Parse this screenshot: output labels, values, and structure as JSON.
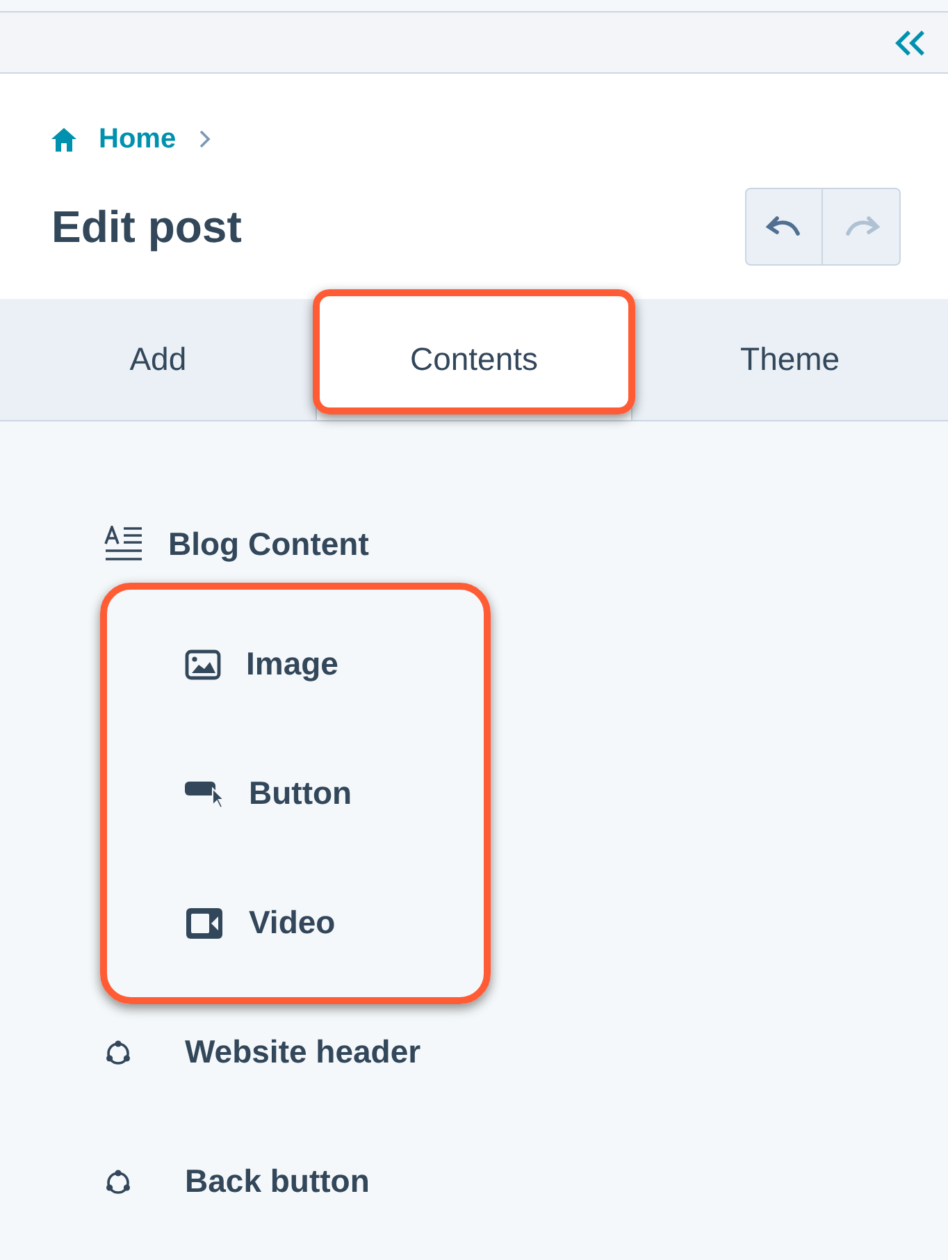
{
  "breadcrumb": {
    "label": "Home"
  },
  "title": "Edit post",
  "history": [
    {
      "kind": "undo",
      "disabled": false
    },
    {
      "kind": "redo",
      "disabled": true
    }
  ],
  "tabs": [
    {
      "label": "Add",
      "selected": false,
      "highlighted": false
    },
    {
      "label": "Contents",
      "selected": true,
      "highlighted": true
    },
    {
      "label": "Theme",
      "selected": false,
      "highlighted": false
    }
  ],
  "items": [
    {
      "label": "Blog Content",
      "kind": "text",
      "children_highlighted": true,
      "children": [
        {
          "label": "Image",
          "kind": "image"
        },
        {
          "label": "Button",
          "kind": "button"
        },
        {
          "label": "Video",
          "kind": "video"
        }
      ]
    },
    {
      "label": "Website header",
      "kind": "module"
    },
    {
      "label": "Back button",
      "kind": "module"
    }
  ]
}
